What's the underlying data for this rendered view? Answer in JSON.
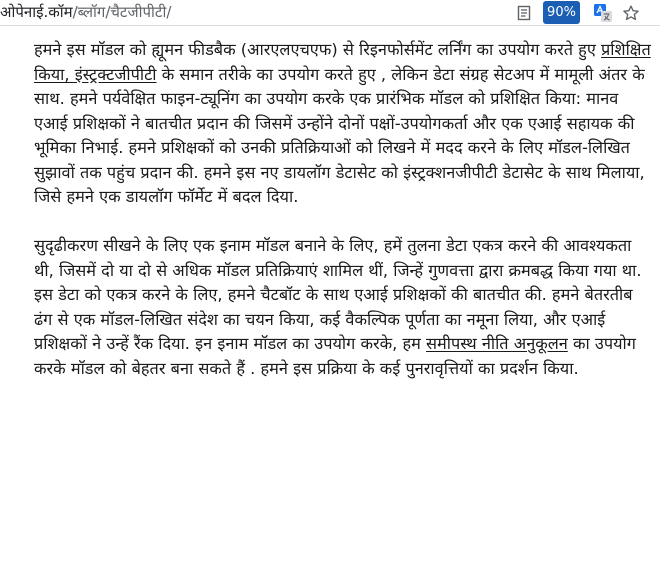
{
  "browser": {
    "url_host": "ओपेनाई.कॉम",
    "url_path": "/ब्लॉग/चैटजीपीटी/",
    "zoom_label": "90%",
    "icons": {
      "reader": "reader-mode-icon",
      "translate": "translate-icon",
      "bookmark": "star-icon"
    },
    "zoom_badge_color": "#1a5fb4"
  },
  "article": {
    "p1": {
      "a": "हमने इस मॉडल को ह्यूमन फीडबैक (आरएलएचएफ) से रिइनफोर्समेंट लर्निंग का उपयोग करते हुए ",
      "b": "प्रशिक्षित किया, इंस्ट्रक्टजीपीटी",
      "c": " के समान तरीके का उपयोग करते हुए , लेकिन डेटा संग्रह सेटअप में मामूली अंतर के साथ. हमने पर्यवेक्षित फाइन-ट्यूनिंग का उपयोग करके एक प्रारंभिक मॉडल को प्रशिक्षित किया: मानव एआई प्रशिक्षकों ने बातचीत प्रदान की जिसमें उन्होंने दोनों पक्षों-उपयोगकर्ता और एक एआई सहायक की भूमिका निभाई. हमने प्रशिक्षकों को उनकी प्रतिक्रियाओं को लिखने में मदद करने के लिए मॉडल-लिखित सुझावों तक पहुंच प्रदान की. हमने इस नए डायलॉग डेटासेट को इंस्ट्रक्शनजीपीटी डेटासेट के साथ मिलाया, जिसे हमने एक डायलॉग फॉर्मेट में बदल दिया."
    },
    "p2": {
      "a": "सुदृढीकरण सीखने के लिए एक इनाम मॉडल बनाने के लिए, हमें तुलना डेटा एकत्र करने की आवश्यकता थी, जिसमें दो या दो से अधिक मॉडल प्रतिक्रियाएं शामिल थीं, जिन्हें गुणवत्ता द्वारा क्रमबद्ध किया गया था. इस डेटा को एकत्र करने के लिए, हमने चैटबॉट के साथ एआई प्रशिक्षकों की बातचीत की. हमने बेतरतीब ढंग से एक मॉडल-लिखित संदेश का चयन किया, कई वैकल्पिक पूर्णता का नमूना लिया, और एआई प्रशिक्षकों ने उन्हें रैंक दिया. इन इनाम मॉडल का उपयोग करके, हम ",
      "b": "समीपस्थ नीति अनुकूलन",
      "c": " का उपयोग करके मॉडल को बेहतर बना सकते हैं . हमने इस प्रक्रिया के कई पुनरावृत्तियों का प्रदर्शन किया."
    }
  }
}
